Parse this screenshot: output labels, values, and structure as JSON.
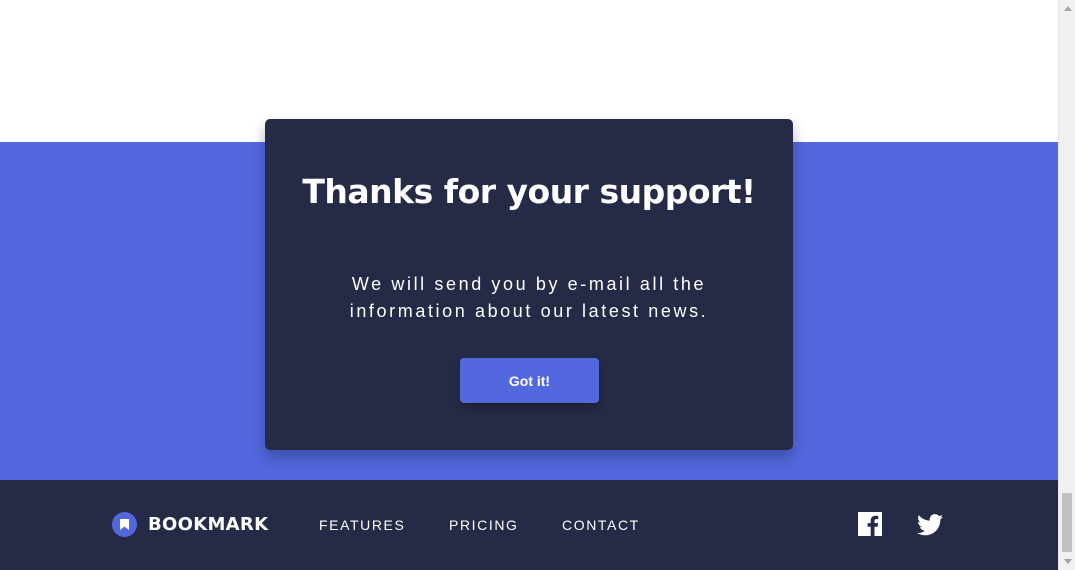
{
  "modal": {
    "title": "Thanks for your support!",
    "message": "We will send you by e-mail all the information about our latest news.",
    "button_label": "Got it!"
  },
  "footer": {
    "logo_text": "BOOKMARK",
    "nav": [
      "FEATURES",
      "PRICING",
      "CONTACT"
    ],
    "social_icons": [
      "facebook-icon",
      "twitter-icon"
    ]
  },
  "colors": {
    "accent": "#5368df",
    "navy": "#252b46",
    "white": "#ffffff"
  }
}
